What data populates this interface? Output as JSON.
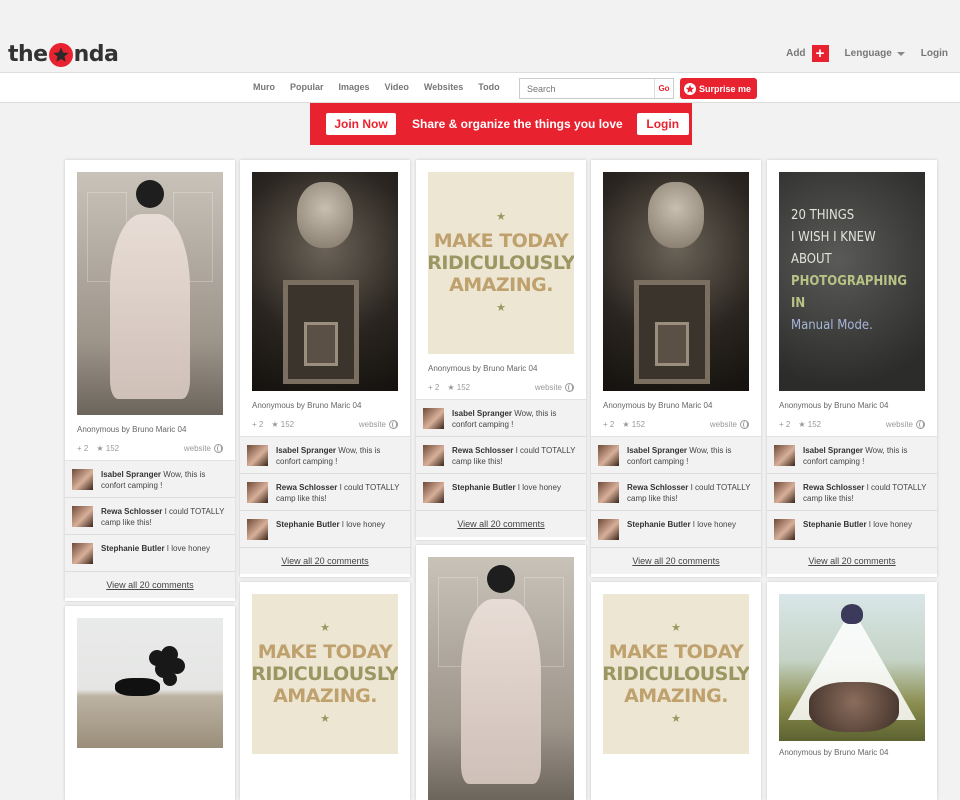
{
  "header": {
    "logo_left": "the",
    "logo_right": "nda",
    "add_label": "Add",
    "language_label": "Lenguage",
    "login_label": "Login"
  },
  "nav": {
    "items": [
      "Muro",
      "Popular",
      "Images",
      "Video",
      "Websites",
      "Todo"
    ],
    "search_placeholder": "Search",
    "search_go": "Go",
    "surprise_label": "Surprise me"
  },
  "banner": {
    "join_label": "Join Now",
    "tagline": "Share & organize the things you love",
    "login_label": "Login"
  },
  "colors": {
    "accent": "#e8222f",
    "background": "#f2f2f2"
  },
  "pin": {
    "meta": "Anonymous by Bruno Maric 04",
    "repins": "+ 2",
    "likes": "★ 152",
    "source": "website",
    "view_all": "View all 20 comments",
    "comments": [
      {
        "name": "Isabel Spranger",
        "text": " Wow, this is confort camping !"
      },
      {
        "name": "Rewa Schlosser",
        "text": " I could TOTALLY camp like this!"
      },
      {
        "name": "Stephanie Butler",
        "text": " I love honey"
      }
    ]
  },
  "posters": {
    "make_today": {
      "line1": "MAKE TODAY",
      "line2": "RIDICULOUSLY",
      "line3": "AMAZING."
    },
    "twenty_things": {
      "line1": "20 THINGS",
      "line2": "I WISH I KNEW",
      "line3": "ABOUT",
      "line4": "PHOTOGRAPHING IN",
      "line5": "Manual Mode."
    }
  }
}
